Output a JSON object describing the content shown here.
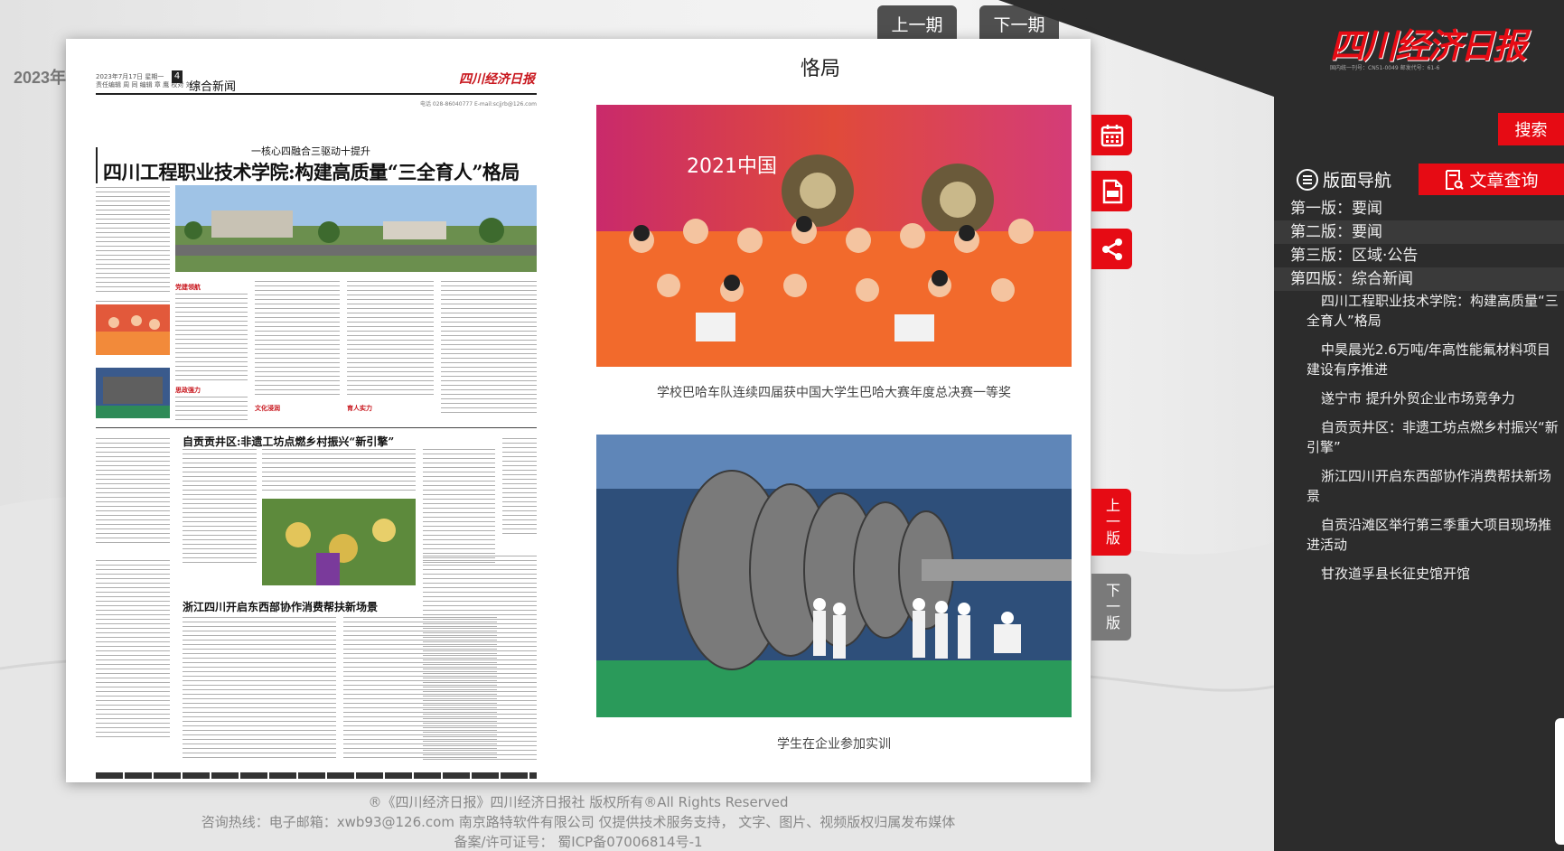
{
  "year": "2023年",
  "issue_nav": {
    "prev": "上一期",
    "next": "下一期"
  },
  "article_title": "恪局",
  "newspaper": {
    "page_number": "4",
    "section": "综合新闻",
    "logo": "四川经济日报",
    "meta_lines": [
      "2023年7月17日  星期一",
      "责任编辑 周 同  编辑 章 鹰  校对 刘 莉"
    ],
    "tiny_meta": "电话 028-86040777  E-mail:scjjrb@126.com",
    "kicker": "一核心四融合三驱动十提升",
    "lead_title": "四川工程职业技术学院:构建高质量“三全育人”格局",
    "sub_heads": [
      "自贡贡井区:非遗工坊点燃乡村振兴“新引擎”",
      "浙江四川开启东西部协作消费帮扶新场景"
    ],
    "red_heads": [
      "党建领航",
      "思政强力",
      "文化浸润",
      "育人实力"
    ]
  },
  "photos": [
    {
      "caption": "学校巴哈车队连续四届获中国大学生巴哈大赛年度总决赛一等奖",
      "banner": "2021中国"
    },
    {
      "caption": "学生在企业参加实训"
    }
  ],
  "page_tabs": {
    "up": "上一版",
    "down": "下一版"
  },
  "masthead": {
    "logo": "四川经济日报",
    "meta": "国内统一刊号：CN51-0049  邮发代号：61-6"
  },
  "search": {
    "placeholder": "",
    "button": "搜索"
  },
  "tabs": {
    "nav": "版面导航",
    "search": "文章查询"
  },
  "editions": [
    "第一版：要闻",
    "第二版：要闻",
    "第三版：区域·公告",
    "第四版：综合新闻"
  ],
  "articles": [
    "四川工程职业技术学院：构建高质量“三全育人”格局",
    "中昊晨光2.6万吨/年高性能氟材料项目建设有序推进",
    "遂宁市 提升外贸企业市场竞争力",
    "自贡贡井区：非遗工坊点燃乡村振兴“新引擎”",
    "浙江四川开启东西部协作消费帮扶新场景",
    "自贡沿滩区举行第三季重大项目现场推进活动",
    "甘孜道孚县长征史馆开馆"
  ],
  "footer": {
    "copyright": "®《四川经济日报》四川经济日报社  版权所有®All Rights Reserved",
    "contact": "咨询热线：电子邮箱：xwb93@126.com     南京路特软件有限公司  仅提供技术服务支持，  文字、图片、视频版权归属发布媒体",
    "icp": "备案/许可证号：    蜀ICP备07006814号-1"
  },
  "colors": {
    "accent": "#e60b14",
    "panel": "#2c2c2c",
    "grey_tab": "#7a7a7a"
  }
}
